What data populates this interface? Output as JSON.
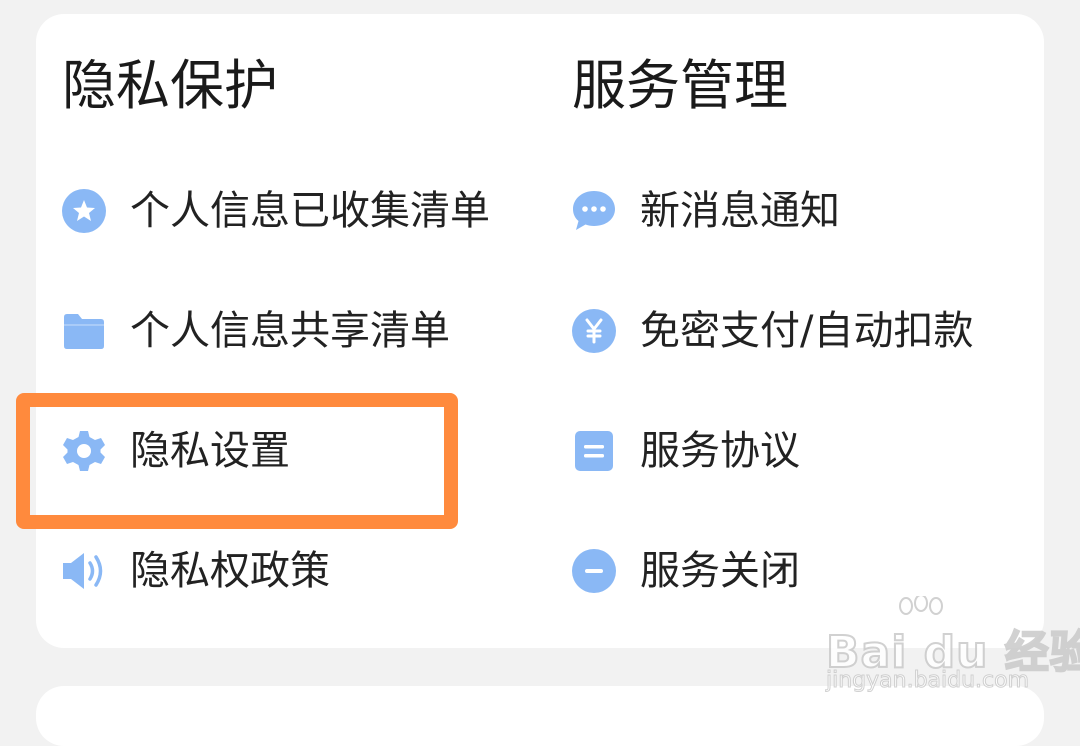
{
  "sections": {
    "privacy": {
      "title": "隐私保护",
      "items": [
        {
          "label": "个人信息已收集清单",
          "icon": "star-circle-icon"
        },
        {
          "label": "个人信息共享清单",
          "icon": "folder-icon"
        },
        {
          "label": "隐私设置",
          "icon": "gear-icon"
        },
        {
          "label": "隐私权政策",
          "icon": "speaker-icon"
        }
      ]
    },
    "service": {
      "title": "服务管理",
      "items": [
        {
          "label": "新消息通知",
          "icon": "chat-bubble-icon"
        },
        {
          "label": "免密支付/自动扣款",
          "icon": "yen-circle-icon"
        },
        {
          "label": "服务协议",
          "icon": "document-icon"
        },
        {
          "label": "服务关闭",
          "icon": "minus-circle-icon"
        }
      ]
    }
  },
  "watermark": {
    "brand": "Bai du 经验",
    "url": "jingyan.baidu.com"
  },
  "colors": {
    "icon": "#8ab8f5",
    "highlight": "#ff8a3d",
    "background": "#f2f2f2",
    "card": "#ffffff"
  }
}
